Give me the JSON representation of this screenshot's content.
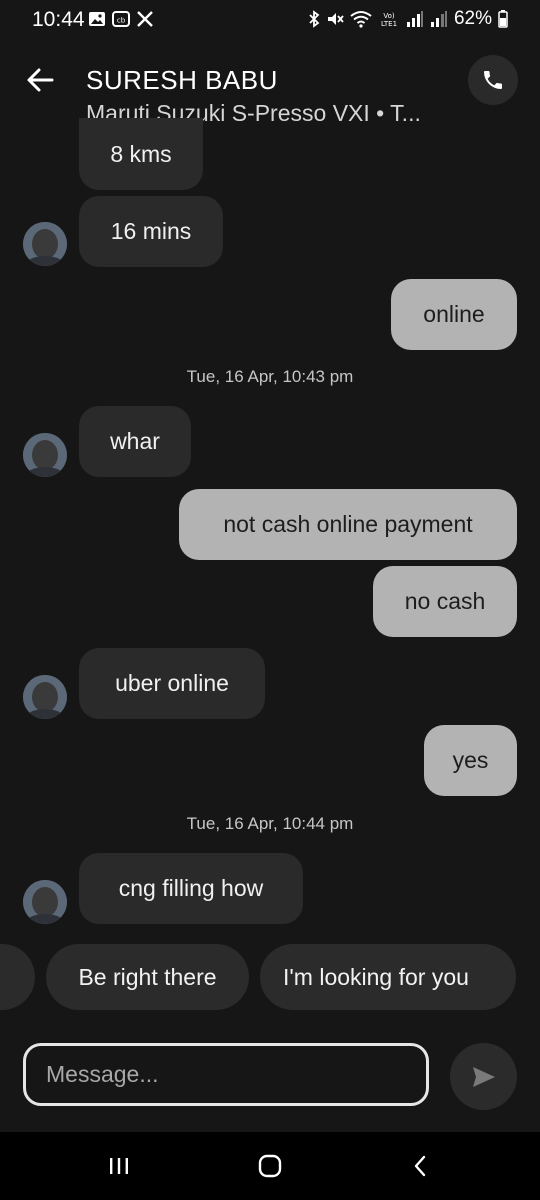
{
  "status_bar": {
    "time": "10:44",
    "battery": "62%",
    "icons_left": [
      "gallery-icon",
      "cb-icon",
      "x-icon"
    ],
    "icons_right": [
      "bluetooth-icon",
      "mute-icon",
      "wifi-icon",
      "volte-icon",
      "signal-icon",
      "signal-icon",
      "battery-icon"
    ]
  },
  "header": {
    "title": "SURESH BABU",
    "subtitle": "Maruti Suzuki S-Presso VXI • T..."
  },
  "messages": [
    {
      "dir": "in",
      "text": "8 kms"
    },
    {
      "dir": "in",
      "text": "16 mins"
    },
    {
      "dir": "out",
      "text": "online"
    },
    {
      "dir": "in",
      "text": "whar"
    },
    {
      "dir": "out",
      "text": "not cash online payment"
    },
    {
      "dir": "out",
      "text": "no cash"
    },
    {
      "dir": "in",
      "text": "uber online"
    },
    {
      "dir": "out",
      "text": "yes"
    },
    {
      "dir": "in",
      "text": "cng filling how"
    }
  ],
  "timestamps": [
    "Tue, 16 Apr, 10:43 pm",
    "Tue, 16 Apr, 10:44 pm"
  ],
  "quick_replies": [
    "Be right there",
    "I'm looking for you"
  ],
  "composer": {
    "placeholder": "Message..."
  },
  "colors": {
    "background": "#161616",
    "incoming_bubble": "#2a2a2a",
    "outgoing_bubble": "#b3b3b3",
    "chip": "#2b2b2b"
  }
}
